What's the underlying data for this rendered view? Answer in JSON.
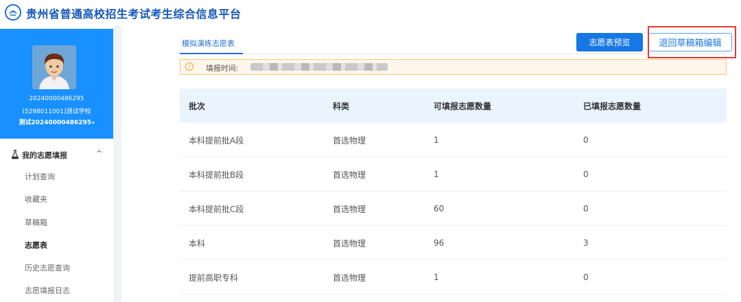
{
  "header": {
    "title": "贵州省普通高校招生考试考生综合信息平台",
    "logo_icon": "university-logo-icon"
  },
  "profile": {
    "id": "20240000486295",
    "school": "(5298011001)测试学校",
    "user": "测试20240000486295",
    "caret": "▾"
  },
  "sidebar": {
    "group_label": "我的志愿填报",
    "group_chevron": "^",
    "items": [
      {
        "label": "计划查询",
        "active": false
      },
      {
        "label": "收藏夹",
        "active": false
      },
      {
        "label": "草稿箱",
        "active": false
      },
      {
        "label": "志愿表",
        "active": true
      },
      {
        "label": "历史志愿查询",
        "active": false
      },
      {
        "label": "志愿填报日志",
        "active": false
      }
    ]
  },
  "main": {
    "tab_label": "模拟演练志愿表",
    "preview_button": "志愿表预览",
    "back_button": "退回草稿箱编辑",
    "notice_label": "填报时间:",
    "notice_icon": "i",
    "table": {
      "headers": [
        "批次",
        "科类",
        "可填报志愿数量",
        "已填报志愿数量"
      ],
      "rows": [
        [
          "本科提前批A段",
          "首选物理",
          "1",
          "0"
        ],
        [
          "本科提前批B段",
          "首选物理",
          "1",
          "0"
        ],
        [
          "本科提前批C段",
          "首选物理",
          "60",
          "0"
        ],
        [
          "本科",
          "首选物理",
          "96",
          "3"
        ],
        [
          "提前高职专科",
          "首选物理",
          "1",
          "0"
        ]
      ]
    }
  },
  "colors": {
    "accent": "#1890ff",
    "title": "#1457b8",
    "highlight": "#e53935",
    "notice_bg": "#fdf6ea"
  }
}
